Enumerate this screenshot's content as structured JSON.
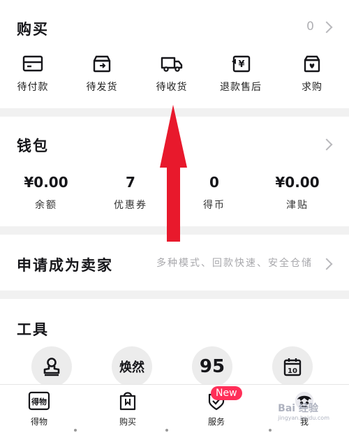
{
  "purchase": {
    "title": "购买",
    "count": "0",
    "items": [
      {
        "label": "待付款",
        "icon": "card-icon"
      },
      {
        "label": "待发货",
        "icon": "box-icon"
      },
      {
        "label": "待收货",
        "icon": "truck-icon"
      },
      {
        "label": "退款售后",
        "icon": "refund-icon"
      },
      {
        "label": "求购",
        "icon": "heart-box-icon"
      }
    ]
  },
  "wallet": {
    "title": "钱包",
    "items": [
      {
        "value": "¥0.00",
        "label": "余额"
      },
      {
        "value": "7",
        "label": "优惠券"
      },
      {
        "value": "0",
        "label": "得币"
      },
      {
        "value": "¥0.00",
        "label": "津贴"
      }
    ]
  },
  "seller": {
    "title": "申请成为卖家",
    "subtitle": "多种模式、回款快速、安全仓储"
  },
  "tools": {
    "title": "工具",
    "items": [
      {
        "icon": "stamp-icon"
      },
      {
        "text": "焕然"
      },
      {
        "text": "95"
      },
      {
        "icon": "calendar-icon",
        "text": "10"
      }
    ]
  },
  "tabbar": {
    "items": [
      {
        "label": "得物",
        "icon_text": "得物"
      },
      {
        "label": "购买",
        "icon": "shopping-bag-icon"
      },
      {
        "label": "服务",
        "icon": "shield-icon"
      },
      {
        "label": "我",
        "icon": "avatar-icon"
      }
    ],
    "badge": "New"
  },
  "watermark": {
    "text": "Bai 经验",
    "sub": "jingyan.baidu.com"
  },
  "colors": {
    "accent": "#ff2f58",
    "arrow": "#e8192c",
    "text": "#16161a",
    "muted": "#a8a8ac",
    "background": "#f1f1f1"
  }
}
